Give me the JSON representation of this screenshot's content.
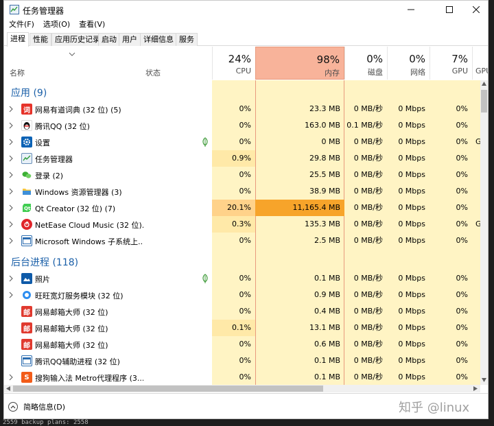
{
  "window": {
    "title": "任务管理器"
  },
  "menu": [
    "文件(F)",
    "选项(O)",
    "查看(V)"
  ],
  "tabs": [
    "进程",
    "性能",
    "应用历史记录",
    "启动",
    "用户",
    "详细信息",
    "服务"
  ],
  "columns": {
    "name": "名称",
    "status": "状态",
    "cpu": {
      "pct": "24%",
      "label": "CPU"
    },
    "memory": {
      "pct": "98%",
      "label": "内存"
    },
    "disk": {
      "pct": "0%",
      "label": "磁盘"
    },
    "network": {
      "pct": "0%",
      "label": "网络"
    },
    "gpu": {
      "pct": "7%",
      "label": "GPU"
    },
    "gpu_engine": {
      "label": "GPU"
    }
  },
  "groups": {
    "apps": "应用 (9)",
    "background": "后台进程 (118)"
  },
  "apps": [
    {
      "name": "网易有道词典 (32 位) (5)",
      "cpu": "0%",
      "mem": "23.3 MB",
      "disk": "0 MB/秒",
      "net": "0 Mbps",
      "gpu": "0%",
      "gpu2": ""
    },
    {
      "name": "腾讯QQ (32 位)",
      "cpu": "0%",
      "mem": "163.0 MB",
      "disk": "0.1 MB/秒",
      "net": "0 Mbps",
      "gpu": "0%",
      "gpu2": ""
    },
    {
      "name": "设置",
      "cpu": "0%",
      "mem": "0 MB",
      "disk": "0 MB/秒",
      "net": "0 Mbps",
      "gpu": "0%",
      "gpu2": "G"
    },
    {
      "name": "任务管理器",
      "cpu": "0.9%",
      "mem": "29.8 MB",
      "disk": "0 MB/秒",
      "net": "0 Mbps",
      "gpu": "0%",
      "gpu2": ""
    },
    {
      "name": "登录 (2)",
      "cpu": "0%",
      "mem": "25.5 MB",
      "disk": "0 MB/秒",
      "net": "0 Mbps",
      "gpu": "0%",
      "gpu2": ""
    },
    {
      "name": "Windows 资源管理器 (3)",
      "cpu": "0%",
      "mem": "38.9 MB",
      "disk": "0 MB/秒",
      "net": "0 Mbps",
      "gpu": "0%",
      "gpu2": ""
    },
    {
      "name": "Qt Creator (32 位) (7)",
      "cpu": "20.1%",
      "mem": "11,165.4 MB",
      "disk": "0 MB/秒",
      "net": "0 Mbps",
      "gpu": "0%",
      "gpu2": ""
    },
    {
      "name": "NetEase Cloud Music (32 位)...",
      "cpu": "0.3%",
      "mem": "135.3 MB",
      "disk": "0 MB/秒",
      "net": "0 Mbps",
      "gpu": "0%",
      "gpu2": "G"
    },
    {
      "name": "Microsoft Windows 子系统上...",
      "cpu": "0%",
      "mem": "2.5 MB",
      "disk": "0 MB/秒",
      "net": "0 Mbps",
      "gpu": "0%",
      "gpu2": ""
    }
  ],
  "background": [
    {
      "name": "照片",
      "cpu": "0%",
      "mem": "0.1 MB",
      "disk": "0 MB/秒",
      "net": "0 Mbps",
      "gpu": "0%",
      "gpu2": ""
    },
    {
      "name": "旺旺宽灯服务模块 (32 位)",
      "cpu": "0%",
      "mem": "0.9 MB",
      "disk": "0 MB/秒",
      "net": "0 Mbps",
      "gpu": "0%",
      "gpu2": ""
    },
    {
      "name": "网易邮箱大师 (32 位)",
      "cpu": "0%",
      "mem": "0.4 MB",
      "disk": "0 MB/秒",
      "net": "0 Mbps",
      "gpu": "0%",
      "gpu2": ""
    },
    {
      "name": "网易邮箱大师 (32 位)",
      "cpu": "0.1%",
      "mem": "13.1 MB",
      "disk": "0 MB/秒",
      "net": "0 Mbps",
      "gpu": "0%",
      "gpu2": ""
    },
    {
      "name": "网易邮箱大师 (32 位)",
      "cpu": "0%",
      "mem": "0.6 MB",
      "disk": "0 MB/秒",
      "net": "0 Mbps",
      "gpu": "0%",
      "gpu2": ""
    },
    {
      "name": "腾讯QQ辅助进程 (32 位)",
      "cpu": "0%",
      "mem": "0.1 MB",
      "disk": "0 MB/秒",
      "net": "0 Mbps",
      "gpu": "0%",
      "gpu2": ""
    },
    {
      "name": "搜狗输入法 Metro代理程序 (3...",
      "cpu": "0%",
      "mem": "0.1 MB",
      "disk": "0 MB/秒",
      "net": "0 Mbps",
      "gpu": "0%",
      "gpu2": ""
    }
  ],
  "footer": {
    "fewer_details": "简略信息(D)",
    "watermark": "知乎 @linux"
  },
  "terminal_line": "2559 backup plans: 2558"
}
